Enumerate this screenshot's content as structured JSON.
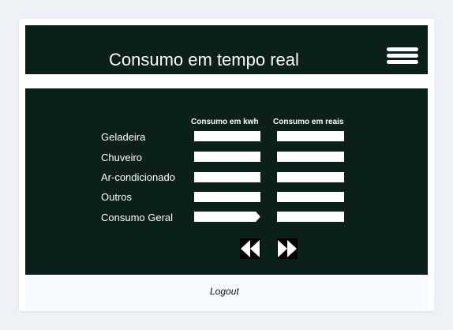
{
  "header": {
    "title": "Consumo em tempo real",
    "menu_icon": "hamburger-menu-icon"
  },
  "table": {
    "columns": [
      "Consumo em kwh",
      "Consumo em reais"
    ],
    "rows": [
      {
        "label": "Geladeira",
        "kwh": "",
        "reais": ""
      },
      {
        "label": "Chuveiro",
        "kwh": "",
        "reais": ""
      },
      {
        "label": "Ar-condicionado",
        "kwh": "",
        "reais": ""
      },
      {
        "label": "Outros",
        "kwh": "",
        "reais": ""
      },
      {
        "label": "Consumo Geral",
        "kwh": "",
        "reais": ""
      }
    ]
  },
  "nav": {
    "previous_icon": "rewind-icon",
    "next_icon": "fast-forward-icon"
  },
  "footer": {
    "logout_label": "Logout"
  },
  "colors": {
    "panel": "#0b201b",
    "background": "#eef1f5",
    "field": "#ffffff"
  }
}
